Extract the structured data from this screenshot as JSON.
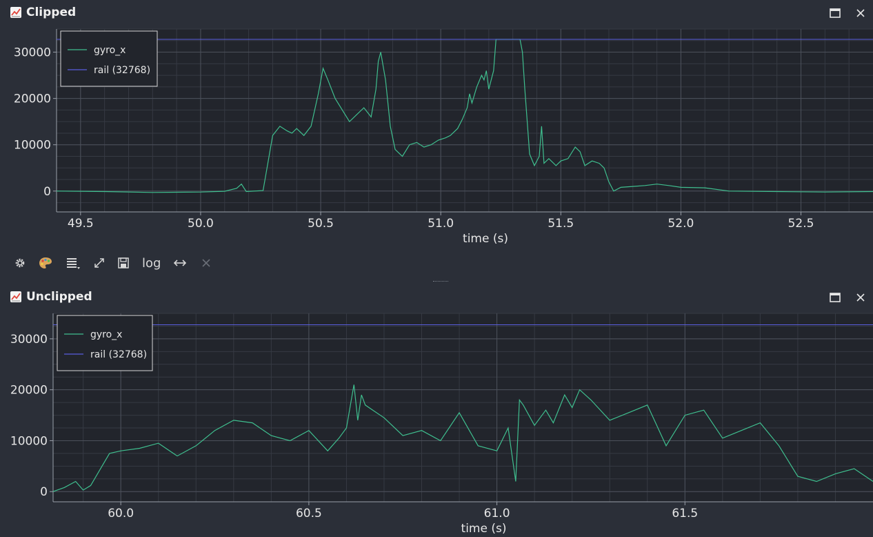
{
  "panels": [
    {
      "title": "Clipped",
      "window_icon": "chart-increasing-icon",
      "maximize_icon": "maximize-icon",
      "close_icon": "close-icon",
      "chart_data": {
        "type": "line",
        "xlabel": "time (s)",
        "ylabel": "",
        "xlim": [
          49.4,
          52.8
        ],
        "ylim": [
          -4500,
          35000
        ],
        "xticks": [
          49.5,
          50.0,
          50.5,
          51.0,
          51.5,
          52.0,
          52.5
        ],
        "xtick_labels": [
          "49.5",
          "50.0",
          "50.5",
          "51.0",
          "51.5",
          "52.0",
          "52.5"
        ],
        "yticks": [
          0,
          10000,
          20000,
          30000
        ],
        "ytick_labels": [
          "0",
          "10000",
          "20000",
          "30000"
        ],
        "grid": true,
        "legend_position": "top-left",
        "series": [
          {
            "name": "gyro_x",
            "color": "#3fbf8f",
            "x": [
              49.4,
              49.6,
              49.8,
              50.0,
              50.1,
              50.15,
              50.17,
              50.19,
              50.26,
              50.28,
              50.3,
              50.33,
              50.36,
              50.38,
              50.4,
              50.43,
              50.46,
              50.49,
              50.51,
              50.53,
              50.56,
              50.59,
              50.62,
              50.65,
              50.68,
              50.71,
              50.73,
              50.74,
              50.75,
              50.77,
              50.79,
              50.81,
              50.84,
              50.87,
              50.9,
              50.93,
              50.96,
              50.99,
              51.02,
              51.04,
              51.07,
              51.09,
              51.11,
              51.12,
              51.13,
              51.15,
              51.17,
              51.18,
              51.19,
              51.2,
              51.21,
              51.22,
              51.23,
              51.25,
              51.28,
              51.3,
              51.33,
              51.34,
              51.35,
              51.37,
              51.39,
              51.41,
              51.42,
              51.43,
              51.45,
              51.48,
              51.5,
              51.53,
              51.56,
              51.58,
              51.6,
              51.63,
              51.66,
              51.68,
              51.7,
              51.72,
              51.75,
              51.8,
              51.85,
              51.9,
              51.95,
              52.0,
              52.1,
              52.2,
              52.4,
              52.6,
              52.8
            ],
            "y": [
              0,
              -100,
              -300,
              -200,
              -50,
              600,
              1500,
              -100,
              100,
              6000,
              12000,
              14000,
              13000,
              12500,
              13500,
              12000,
              14000,
              21000,
              26500,
              24000,
              20000,
              17500,
              15000,
              16500,
              18000,
              16000,
              22000,
              28000,
              30000,
              24000,
              14000,
              9000,
              7500,
              10000,
              10500,
              9500,
              10000,
              11000,
              11500,
              12000,
              13500,
              15500,
              18000,
              21000,
              19000,
              22500,
              25000,
              24000,
              26000,
              22000,
              24000,
              26000,
              32768,
              32768,
              32768,
              32768,
              32768,
              30000,
              22000,
              8000,
              5500,
              7500,
              14000,
              6000,
              7000,
              5500,
              6500,
              7000,
              9500,
              8500,
              5500,
              6500,
              6000,
              5000,
              2000,
              0,
              800,
              1000,
              1200,
              1500,
              1200,
              800,
              700,
              0,
              -100,
              -200,
              -100
            ]
          },
          {
            "name": "rail (32768)",
            "color": "#5a5ee0",
            "x": [
              49.4,
              52.8
            ],
            "y": [
              32768,
              32768
            ]
          }
        ]
      }
    },
    {
      "title": "Unclipped",
      "window_icon": "chart-increasing-icon",
      "maximize_icon": "maximize-icon",
      "close_icon": "close-icon",
      "chart_data": {
        "type": "line",
        "xlabel": "time (s)",
        "ylabel": "",
        "xlim": [
          59.82,
          62.0
        ],
        "ylim": [
          -2000,
          35000
        ],
        "xticks": [
          60.0,
          60.5,
          61.0,
          61.5
        ],
        "xtick_labels": [
          "60.0",
          "60.5",
          "61.0",
          "61.5"
        ],
        "yticks": [
          0,
          10000,
          20000,
          30000
        ],
        "ytick_labels": [
          "0",
          "10000",
          "20000",
          "30000"
        ],
        "grid": true,
        "legend_position": "top-left",
        "series": [
          {
            "name": "gyro_x",
            "color": "#3fbf8f",
            "x": [
              59.82,
              59.85,
              59.88,
              59.9,
              59.92,
              59.95,
              59.97,
              60.0,
              60.05,
              60.1,
              60.15,
              60.2,
              60.25,
              60.3,
              60.35,
              60.4,
              60.45,
              60.5,
              60.55,
              60.58,
              60.6,
              60.62,
              60.63,
              60.64,
              60.65,
              60.67,
              60.7,
              60.75,
              60.8,
              60.85,
              60.9,
              60.95,
              61.0,
              61.03,
              61.05,
              61.06,
              61.07,
              61.1,
              61.13,
              61.15,
              61.18,
              61.2,
              61.22,
              61.25,
              61.3,
              61.35,
              61.4,
              61.45,
              61.5,
              61.55,
              61.6,
              61.65,
              61.7,
              61.75,
              61.8,
              61.85,
              61.9,
              61.95,
              62.0
            ],
            "y": [
              0,
              800,
              2000,
              300,
              1200,
              5000,
              7500,
              8000,
              8500,
              9500,
              7000,
              9000,
              12000,
              14000,
              13500,
              11000,
              10000,
              12000,
              8000,
              10500,
              12500,
              21000,
              14000,
              19000,
              17000,
              16000,
              14500,
              11000,
              12000,
              10000,
              15500,
              9000,
              8000,
              12500,
              2000,
              18000,
              17000,
              13000,
              16000,
              13500,
              19000,
              16500,
              20000,
              18000,
              14000,
              15500,
              17000,
              9000,
              15000,
              16000,
              10500,
              12000,
              13500,
              9000,
              3000,
              2000,
              3500,
              4500,
              2000
            ]
          },
          {
            "name": "rail (32768)",
            "color": "#5a5ee0",
            "x": [
              59.82,
              62.0
            ],
            "y": [
              32768,
              32768
            ]
          }
        ]
      }
    }
  ],
  "toolbar": {
    "settings_icon": "gear-icon",
    "palette_icon": "palette-icon",
    "layout_icon": "list-dropdown-icon",
    "expand_icon": "expand-icon",
    "save_icon": "save-icon",
    "log_label": "log",
    "fit_icon": "horizontal-arrows-icon",
    "clear_icon": "close-icon"
  }
}
